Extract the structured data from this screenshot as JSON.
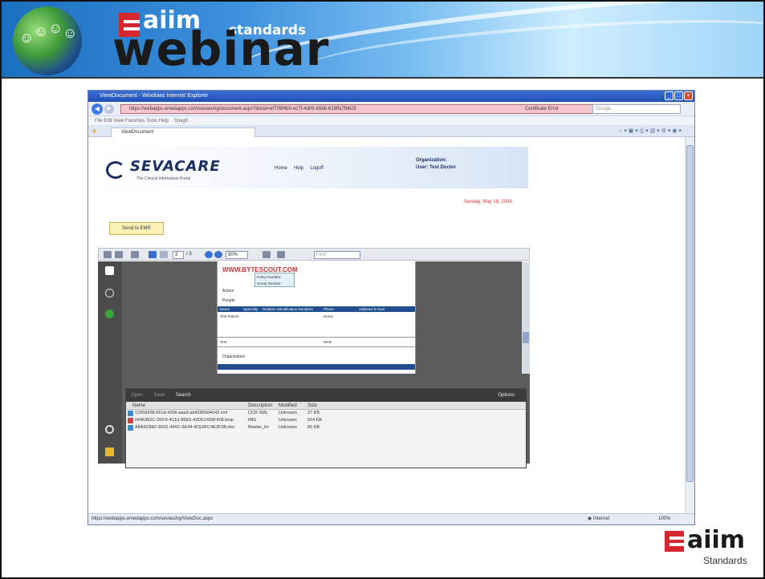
{
  "banner": {
    "brand_small": "aiim",
    "brand_main": "webinar",
    "brand_tag": "standards"
  },
  "browser": {
    "title": "ViewDocument - Windows Internet Explorer",
    "url": "https://webapps.emedapps.com/sevaschg/document.aspx?docid=ef709f4b0-ec7f-4d09-b566-618ffa7fb625",
    "cert_error": "Certificate Error",
    "search_placeholder": "Google",
    "menu": "File   Edit   View   Favorites   Tools   Help",
    "snagit": "SnagIt",
    "tab": "ViewDocument",
    "status_url": "https://webapps.emedapps.com/sevaschg/ViewDoc.aspx",
    "zone": "Internet",
    "zoom": "100%"
  },
  "app": {
    "logo": "SEVACARE",
    "tagline": "The Clinical Information Portal",
    "nav": [
      "Home",
      "Help",
      "Logoff"
    ],
    "org_label": "Organization:",
    "user_label": "User: Test Doctor",
    "date": "Sunday, May 18, 2008",
    "send_button": "Send to EMR"
  },
  "viewer": {
    "page_field": "3",
    "page_total": "/ 3",
    "zoom_field": "90%",
    "find_placeholder": "Find",
    "doc_watermark": "WWW.BYTESCOUT.COM",
    "doc_sections": [
      "Actors",
      "People",
      "Organization"
    ],
    "people_headers": [
      "Name",
      "Specialty",
      "Relation",
      "Identification Numbers",
      "Phone",
      "Address/ E-mail"
    ],
    "policy_label": "Policy Number:",
    "group_label": "Group Number:",
    "person_name": "Test Patient",
    "phone_type": "Home",
    "work_type": "Work",
    "test_label": "Test"
  },
  "attachments": {
    "toolbar": [
      "Open",
      "Save",
      "Search"
    ],
    "options": "Options",
    "columns": [
      "Name",
      "Description",
      "Modified",
      "Size"
    ],
    "rows": [
      {
        "name": "12958208-651d-439b-aaa3-ab42809d4042.xml",
        "desc": "CCR XML",
        "modified": "Unknown",
        "size": "27 KB"
      },
      {
        "name": "0446382C-D0F9-4C51-86E6-42DE1439F408.bmp",
        "desc": "IMG",
        "modified": "Unknown",
        "size": "914 KB"
      },
      {
        "name": "A8A9C8EF-6001-449C-9E44-4CE9FC4E3F3B.doc",
        "desc": "Master_Im",
        "modified": "Unknown",
        "size": "80 KB"
      }
    ]
  },
  "footer_logo": {
    "word": "aiim",
    "sub": "Standards"
  }
}
